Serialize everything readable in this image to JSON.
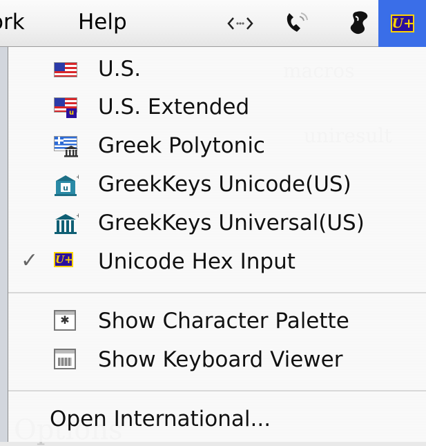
{
  "menubar": {
    "work_label": "ork",
    "help_label": "Help",
    "extras": [
      {
        "icon": "code-brackets-icon"
      },
      {
        "icon": "phone-icon"
      },
      {
        "icon": "script-icon"
      },
      {
        "icon": "unicode-input-icon",
        "badge": "U+"
      }
    ]
  },
  "menu": {
    "items": [
      {
        "label": "U.S.",
        "icon": "us-flag-icon",
        "checked": false
      },
      {
        "label": "U.S. Extended",
        "icon": "us-extended-flag-icon",
        "checked": false
      },
      {
        "label": "Greek Polytonic",
        "icon": "greek-flag-icon",
        "checked": false
      },
      {
        "label": "GreekKeys Unicode(US)",
        "icon": "greekkeys-unicode-icon",
        "checked": false
      },
      {
        "label": "GreekKeys Universal(US)",
        "icon": "greekkeys-universal-icon",
        "checked": false
      },
      {
        "label": "Unicode Hex Input",
        "icon": "unicode-hex-icon",
        "badge": "U+",
        "checked": true,
        "check_mark": "✓"
      }
    ],
    "tools": [
      {
        "label": "Show Character Palette",
        "icon": "character-palette-icon",
        "glyph": "✱"
      },
      {
        "label": "Show Keyboard Viewer",
        "icon": "keyboard-viewer-icon"
      }
    ],
    "footer": {
      "label": "Open International..."
    }
  },
  "colors": {
    "accent": "#3a6ee8",
    "badge_bg": "#2a0f9e",
    "badge_fg": "#ffd400"
  }
}
